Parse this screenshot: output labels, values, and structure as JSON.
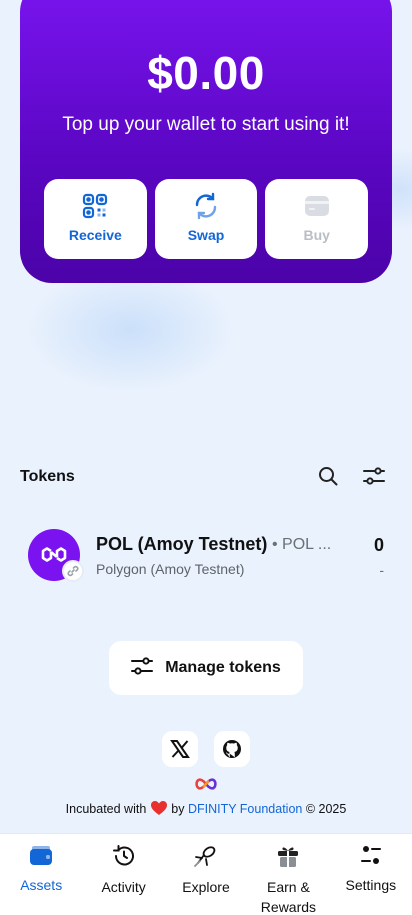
{
  "hero": {
    "balance": "$0.00",
    "subtitle": "Top up your wallet to start using it!",
    "actions": [
      {
        "label": "Receive",
        "icon": "qr-code-icon"
      },
      {
        "label": "Swap",
        "icon": "swap-icon"
      },
      {
        "label": "Buy",
        "icon": "card-icon",
        "disabled": true
      }
    ]
  },
  "tokens": {
    "title": "Tokens",
    "search_icon": "search-icon",
    "filter_icon": "filter-icon",
    "items": [
      {
        "name": "POL (Amoy Testnet)",
        "symbol": "• POL ...",
        "network": "Polygon (Amoy Testnet)",
        "balance": "0",
        "usd": "-"
      }
    ]
  },
  "manage_tokens": {
    "label": "Manage tokens"
  },
  "socials": [
    "x-icon",
    "github-icon"
  ],
  "footer": {
    "prefix": "Incubated with",
    "by": "by",
    "link": "DFINITY Foundation",
    "suffix": "© 2025"
  },
  "nav": [
    {
      "label": "Assets",
      "active": true
    },
    {
      "label": "Activity"
    },
    {
      "label": "Explore"
    },
    {
      "label": "Earn & Rewards"
    },
    {
      "label": "Settings"
    }
  ],
  "colors": {
    "accent": "#1366d6",
    "hero_purple": "#6a0ee0"
  }
}
